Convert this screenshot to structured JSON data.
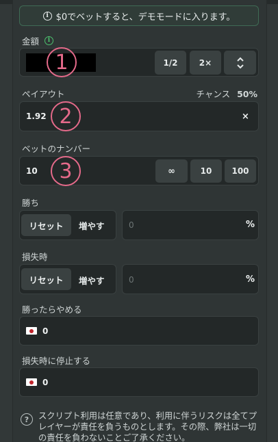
{
  "notice": {
    "text": "$0でベットすると、デモモードに入ります。",
    "icon": "info-icon"
  },
  "amount": {
    "label": "金額",
    "half_label": "1/2",
    "double_label": "2×",
    "marker": "1"
  },
  "payout": {
    "label": "ペイアウト",
    "chance_label": "チャンス",
    "chance_value": "50%",
    "value": "1.92",
    "clear_symbol": "×",
    "marker": "2"
  },
  "bet_count": {
    "label": "ベットのナンバー",
    "value": "10",
    "infinity_label": "∞",
    "ten_label": "10",
    "hundred_label": "100",
    "marker": "3"
  },
  "on_win": {
    "label": "勝ち",
    "reset_label": "リセット",
    "increase_label": "増やす",
    "placeholder": "0",
    "unit": "%"
  },
  "on_loss": {
    "label": "損失時",
    "reset_label": "リセット",
    "increase_label": "増やす",
    "placeholder": "0",
    "unit": "%"
  },
  "stop_on_profit": {
    "label": "勝ったらやめる",
    "value": "0"
  },
  "stop_on_loss": {
    "label": "損失時に停止する",
    "value": "0"
  },
  "footer": {
    "text": "スクリプト利用は任意であり、利用に伴うリスクは全てプレイヤーが責任を負うものとします。その際、弊社は一切の責任を負わないことご了承ください。"
  },
  "colors": {
    "accent_green": "#37a55a",
    "marker_pink": "#e56a8a",
    "panel": "#2f3535",
    "field": "#232828"
  }
}
